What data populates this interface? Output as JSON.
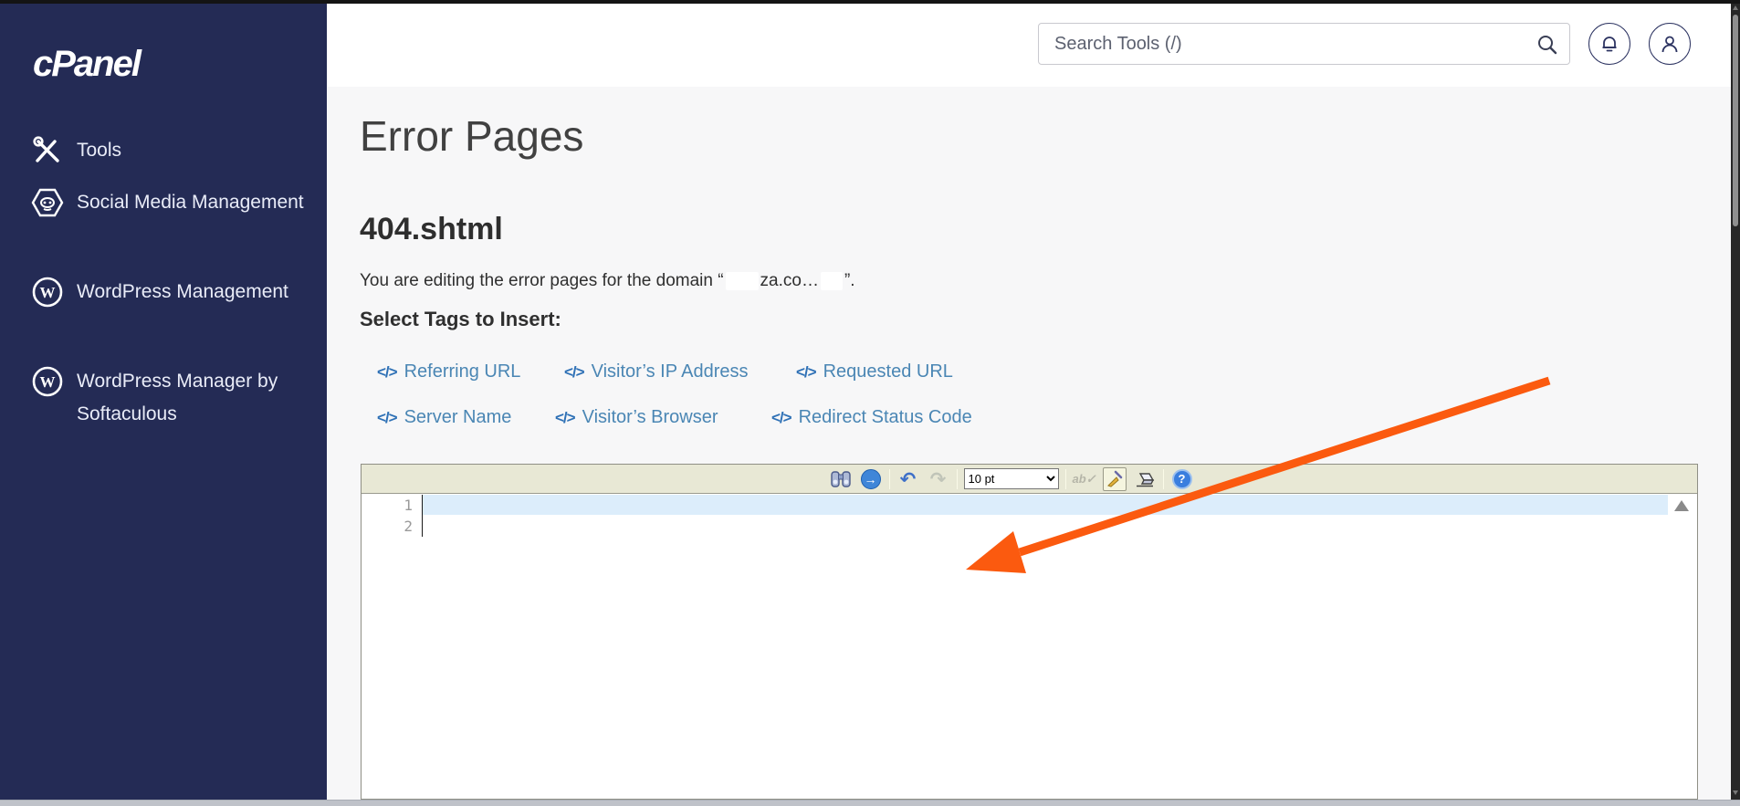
{
  "colors": {
    "sidebar_bg": "#242b55",
    "content_bg": "#f7f7f8",
    "link_blue": "#4a86b4",
    "tag_icon_blue": "#2f71b6",
    "toolbar_bg": "#e8e8d5",
    "current_line_highlight": "#dcedfb",
    "annotation_arrow": "#fb5a0f"
  },
  "sidebar": {
    "logo": "cPanel",
    "items": [
      {
        "icon": "tools-icon",
        "label": "Tools"
      },
      {
        "icon": "social-media-icon",
        "label": "Social Media Management"
      },
      {
        "icon": "wordpress-icon",
        "label": "WordPress Management"
      },
      {
        "icon": "wordpress-icon",
        "label": "WordPress Manager by Softaculous"
      }
    ]
  },
  "header": {
    "search_placeholder": "Search Tools (/)",
    "icons": [
      "search-icon",
      "bell-icon",
      "user-icon"
    ]
  },
  "main": {
    "page_title": "Error Pages",
    "file_title": "404.shtml",
    "editing_text_prefix": "You are editing the error pages for the domain “",
    "domain_visible": "za.co…",
    "editing_text_suffix": "”.",
    "select_tags_label": "Select Tags to Insert:",
    "tags": [
      "Referring URL",
      "Visitor’s IP Address",
      "Requested URL",
      "Server Name",
      "Visitor’s Browser",
      "Redirect Status Code"
    ],
    "editor": {
      "toolbar_icons": [
        "find-binoculars-icon",
        "goto-icon",
        "undo-icon",
        "redo-icon",
        "font-size-select",
        "spellcheck-icon",
        "brush-icon",
        "eraser-icon",
        "help-icon"
      ],
      "font_size_value": "10 pt",
      "go_glyph": "→",
      "undo_glyph": "↶",
      "redo_glyph": "↷",
      "spell_glyph": "ab✓",
      "help_glyph": "?",
      "line_numbers": [
        "1",
        "2"
      ]
    }
  },
  "annotation": {
    "type": "arrow",
    "color": "#fb5a0f"
  }
}
